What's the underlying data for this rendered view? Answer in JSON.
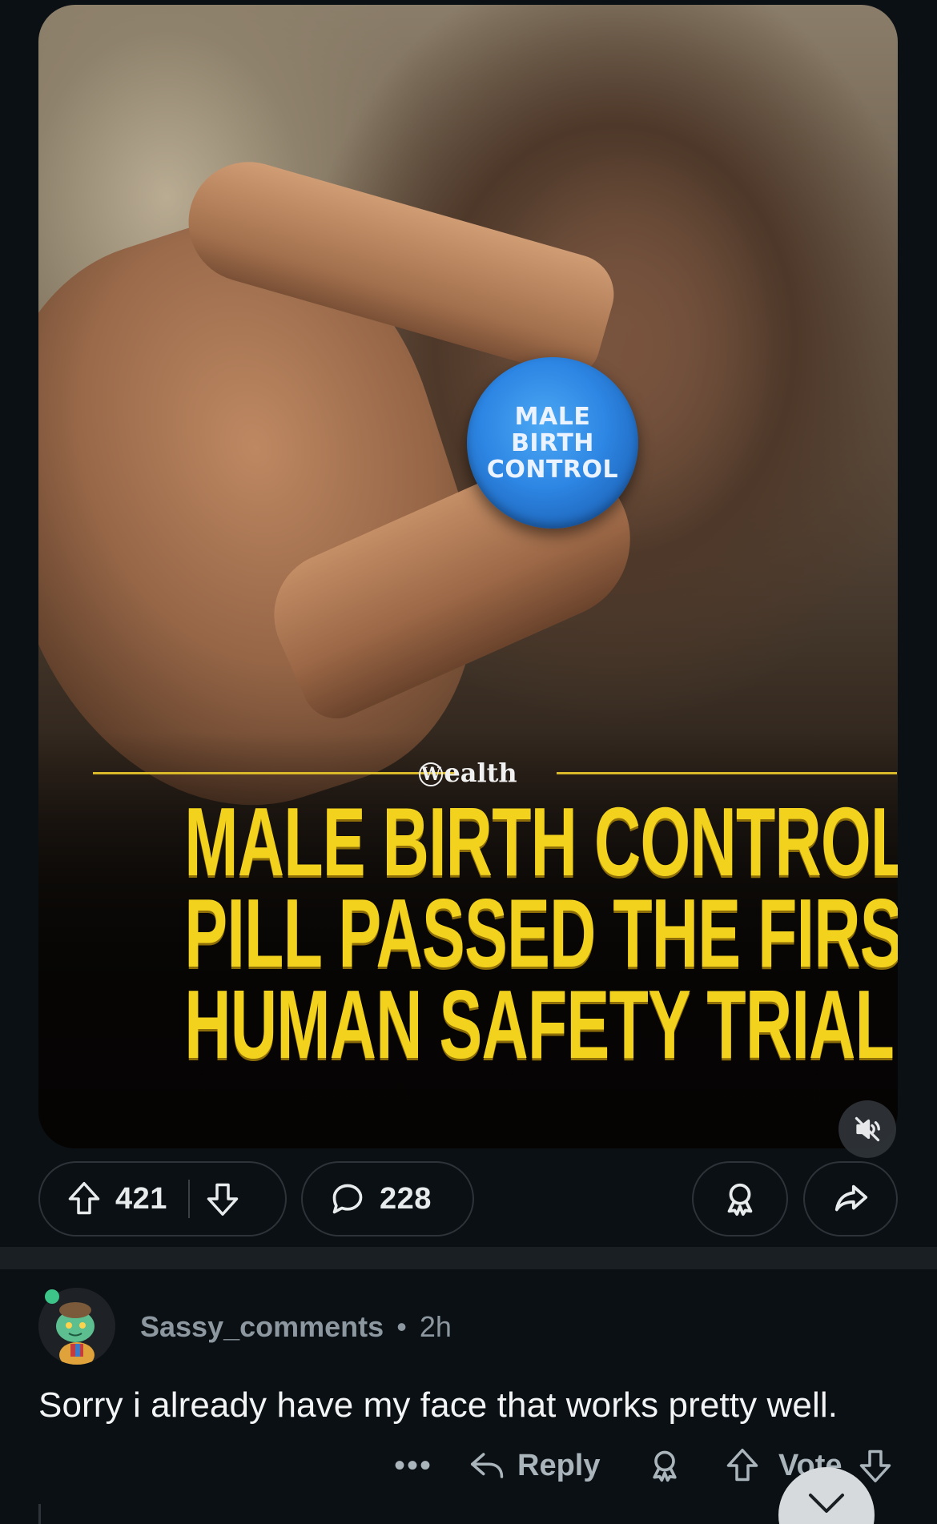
{
  "post": {
    "image": {
      "pill_text": [
        "MALE",
        "BIRTH",
        "CONTROL"
      ],
      "brand": "Wealth",
      "brand_initial": "W",
      "brand_rest": "ealth",
      "headline": [
        "MALE BIRTH CONTROL",
        "PILL PASSED THE FIRST",
        "HUMAN SAFETY TRIAL"
      ],
      "mute_icon": "muted-speaker-icon"
    },
    "actions": {
      "upvotes": "421",
      "comments": "228",
      "icons": [
        "upvote-icon",
        "downvote-icon",
        "comment-icon",
        "award-icon",
        "share-icon"
      ]
    }
  },
  "comment": {
    "username": "Sassy_comments",
    "separator": "•",
    "time": "2h",
    "body": "Sorry i already have my face that works pretty well.",
    "actions": {
      "more": "•••",
      "reply": "Reply",
      "vote": "Vote"
    }
  },
  "colors": {
    "background": "#0b1015",
    "headline": "#f2d21d",
    "pill": "#2d86e3",
    "online_dot": "#3dc589",
    "muted_text": "#8c979f"
  }
}
